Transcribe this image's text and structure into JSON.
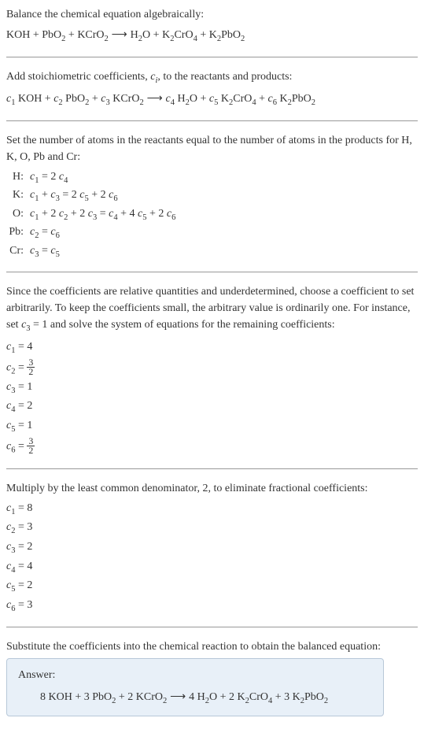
{
  "section1": {
    "line1": "Balance the chemical equation algebraically:",
    "eq_parts": {
      "r1": "KOH",
      "plus1": " + ",
      "r2": "PbO",
      "r2sub": "2",
      "plus2": " + ",
      "r3": "KCrO",
      "r3sub": "2",
      "arrow": " ⟶ ",
      "p1": "H",
      "p1sub": "2",
      "p1b": "O",
      "plus3": " + ",
      "p2": "K",
      "p2sub": "2",
      "p2b": "CrO",
      "p2sub2": "4",
      "plus4": " + ",
      "p3": "K",
      "p3sub": "2",
      "p3b": "PbO",
      "p3sub2": "2"
    }
  },
  "section2": {
    "line1a": "Add stoichiometric coefficients, ",
    "ci": "c",
    "ci_sub": "i",
    "line1b": ", to the reactants and products:",
    "eq": {
      "c1": "c",
      "c1s": "1",
      "sp1": " KOH + ",
      "c2": "c",
      "c2s": "2",
      "sp2": " PbO",
      "pbo2s": "2",
      "sp3": " + ",
      "c3": "c",
      "c3s": "3",
      "sp4": " KCrO",
      "kcro2s": "2",
      "arrow": " ⟶ ",
      "c4": "c",
      "c4s": "4",
      "sp5": " H",
      "h2s": "2",
      "sp5b": "O + ",
      "c5": "c",
      "c5s": "5",
      "sp6": " K",
      "k2s": "2",
      "sp6b": "CrO",
      "cro4s": "4",
      "sp7": " + ",
      "c6": "c",
      "c6s": "6",
      "sp8": " K",
      "k2bs": "2",
      "sp8b": "PbO",
      "pbo2bs": "2"
    }
  },
  "section3": {
    "text": "Set the number of atoms in the reactants equal to the number of atoms in the products for H, K, O, Pb and Cr:",
    "rows": [
      {
        "label": "H:",
        "eq_c1": "c",
        "eq_c1s": "1",
        "eq_mid": " = 2 ",
        "eq_c2": "c",
        "eq_c2s": "4"
      },
      {
        "label": "K:",
        "full": true,
        "c1": "c",
        "s1": "1",
        "t1": " + ",
        "c2": "c",
        "s2": "3",
        "t2": " = 2 ",
        "c3": "c",
        "s3": "5",
        "t3": " + 2 ",
        "c4": "c",
        "s4": "6"
      },
      {
        "label": "O:",
        "full": true,
        "c1": "c",
        "s1": "1",
        "t1": " + 2 ",
        "c2": "c",
        "s2": "2",
        "t2": " + 2 ",
        "c3": "c",
        "s3": "3",
        "t3": " = ",
        "c4": "c",
        "s4": "4",
        "t4": " + 4 ",
        "c5": "c",
        "s5": "5",
        "t5": " + 2 ",
        "c6": "c",
        "s6": "6"
      },
      {
        "label": "Pb:",
        "eq_c1": "c",
        "eq_c1s": "2",
        "eq_mid": " = ",
        "eq_c2": "c",
        "eq_c2s": "6"
      },
      {
        "label": "Cr:",
        "eq_c1": "c",
        "eq_c1s": "3",
        "eq_mid": " = ",
        "eq_c2": "c",
        "eq_c2s": "5"
      }
    ]
  },
  "section4": {
    "text1": "Since the coefficients are relative quantities and underdetermined, choose a coefficient to set arbitrarily. To keep the coefficients small, the arbitrary value is ordinarily one. For instance, set ",
    "c3": "c",
    "c3s": "3",
    "text2": " = 1 and solve the system of equations for the remaining coefficients:",
    "coefs": [
      {
        "c": "c",
        "s": "1",
        "eq": " = 4"
      },
      {
        "c": "c",
        "s": "2",
        "eq": " = ",
        "frac": true,
        "num": "3",
        "den": "2"
      },
      {
        "c": "c",
        "s": "3",
        "eq": " = 1"
      },
      {
        "c": "c",
        "s": "4",
        "eq": " = 2"
      },
      {
        "c": "c",
        "s": "5",
        "eq": " = 1"
      },
      {
        "c": "c",
        "s": "6",
        "eq": " = ",
        "frac": true,
        "num": "3",
        "den": "2"
      }
    ]
  },
  "section5": {
    "text": "Multiply by the least common denominator, 2, to eliminate fractional coefficients:",
    "coefs": [
      {
        "c": "c",
        "s": "1",
        "eq": " = 8"
      },
      {
        "c": "c",
        "s": "2",
        "eq": " = 3"
      },
      {
        "c": "c",
        "s": "3",
        "eq": " = 2"
      },
      {
        "c": "c",
        "s": "4",
        "eq": " = 4"
      },
      {
        "c": "c",
        "s": "5",
        "eq": " = 2"
      },
      {
        "c": "c",
        "s": "6",
        "eq": " = 3"
      }
    ]
  },
  "section6": {
    "text": "Substitute the coefficients into the chemical reaction to obtain the balanced equation:",
    "answer_label": "Answer:",
    "answer": {
      "t1": "8 KOH + 3 PbO",
      "s1": "2",
      "t2": " + 2 KCrO",
      "s2": "2",
      "arrow": " ⟶ ",
      "t3": "4 H",
      "s3": "2",
      "t3b": "O + 2 K",
      "s4": "2",
      "t4": "CrO",
      "s5": "4",
      "t5": " + 3 K",
      "s6": "2",
      "t6": "PbO",
      "s7": "2"
    }
  }
}
